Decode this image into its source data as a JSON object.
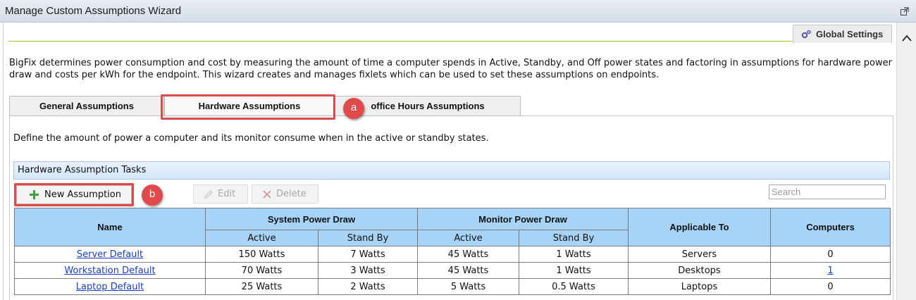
{
  "window": {
    "title": "Manage Custom Assumptions Wizard"
  },
  "global_settings_label": "Global Settings",
  "intro_text": "BigFix determines power consumption and cost by measuring the amount of time a computer spends in Active, Standby, and Off power states and factoring in assumptions for hardware power draw and costs per kWh for the endpoint. This wizard creates and manages fixlets which can be used to set these assumptions on endpoints.",
  "tabs": [
    {
      "label": "General Assumptions"
    },
    {
      "label": "Hardware Assumptions",
      "selected": true
    },
    {
      "label": "office Hours Assumptions"
    }
  ],
  "callouts": {
    "a": "a",
    "b": "b"
  },
  "panel_description": "Define the amount of power a computer and its monitor consume when in the active or standby states.",
  "section_title": "Hardware Assumption Tasks",
  "toolbar": {
    "new_label": "New Assumption",
    "edit_label": "Edit",
    "delete_label": "Delete"
  },
  "search": {
    "placeholder": "Search"
  },
  "table": {
    "headers": {
      "name": "Name",
      "system": "System Power Draw",
      "monitor": "Monitor Power Draw",
      "applicable": "Applicable To",
      "computers": "Computers",
      "active": "Active",
      "standby": "Stand By"
    },
    "rows": [
      {
        "name": "Server Default",
        "sys_active": "150 Watts",
        "sys_standby": "7 Watts",
        "mon_active": "45 Watts",
        "mon_standby": "1 Watts",
        "applicable": "Servers",
        "computers": "0"
      },
      {
        "name": "Workstation Default",
        "sys_active": "70 Watts",
        "sys_standby": "3 Watts",
        "mon_active": "45 Watts",
        "mon_standby": "1 Watts",
        "applicable": "Desktops",
        "computers": "1"
      },
      {
        "name": "Laptop Default",
        "sys_active": "25 Watts",
        "sys_standby": "2 Watts",
        "mon_active": "5 Watts",
        "mon_standby": "0.5 Watts",
        "applicable": "Laptops",
        "computers": "0"
      }
    ]
  },
  "colors": {
    "highlight": "#e0484a",
    "header_blue": "#a7d3f7",
    "link": "#1a3ccc",
    "accent_line": "#9acd32"
  }
}
